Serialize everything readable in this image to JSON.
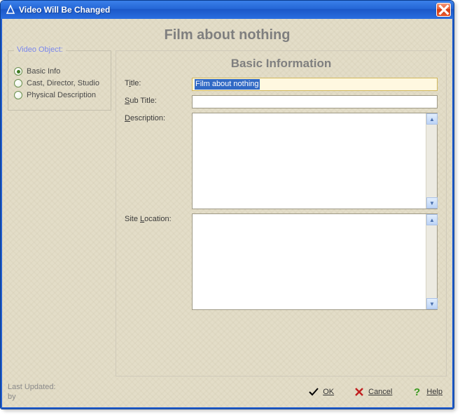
{
  "window": {
    "title": "Video Will Be Changed"
  },
  "header": {
    "title": "Film about nothing"
  },
  "sidebar": {
    "legend": "Video Object:",
    "items": [
      {
        "label": "Basic Info",
        "checked": true
      },
      {
        "label": "Cast, Director, Studio",
        "checked": false
      },
      {
        "label": "Physical Description",
        "checked": false
      }
    ]
  },
  "panel": {
    "heading": "Basic Information",
    "fields": {
      "title": {
        "label_pre": "T",
        "label_ul": "i",
        "label_post": "tle:",
        "value": "Film about nothing",
        "selected": true
      },
      "subtitle": {
        "label_pre": "",
        "label_ul": "S",
        "label_post": "ub Title:",
        "value": ""
      },
      "description": {
        "label_pre": "",
        "label_ul": "D",
        "label_post": "escription:",
        "value": ""
      },
      "sitelocation": {
        "label_pre": "Site ",
        "label_ul": "L",
        "label_post": "ocation:",
        "value": ""
      }
    }
  },
  "footer": {
    "last_updated": "Last Updated:",
    "by": "by",
    "buttons": {
      "ok": "OK",
      "cancel": "Cancel",
      "help": "Help"
    }
  }
}
